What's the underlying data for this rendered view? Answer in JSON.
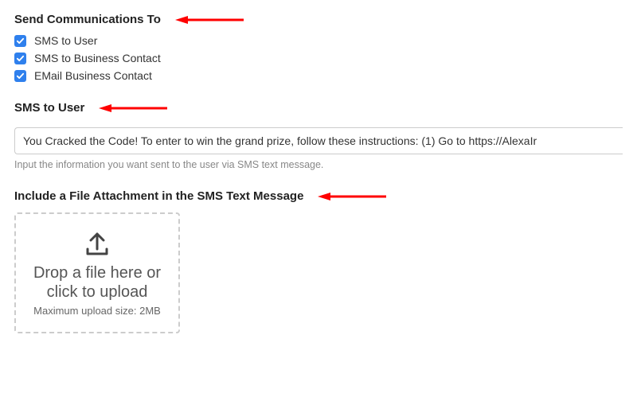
{
  "section1": {
    "heading": "Send Communications To",
    "checkboxes": [
      {
        "label": "SMS to User",
        "checked": true
      },
      {
        "label": "SMS to Business Contact",
        "checked": true
      },
      {
        "label": "EMail Business Contact",
        "checked": true
      }
    ]
  },
  "section2": {
    "heading": "SMS to User",
    "input_value": "You Cracked the Code! To enter to win the grand prize, follow these instructions: (1) Go to https://AlexaIr",
    "help": "Input the information you want sent to the user via SMS text message."
  },
  "section3": {
    "heading": "Include a File Attachment in the SMS Text Message",
    "dropzone_text": "Drop a file here or click to upload",
    "dropzone_sub": "Maximum upload size: 2MB"
  }
}
